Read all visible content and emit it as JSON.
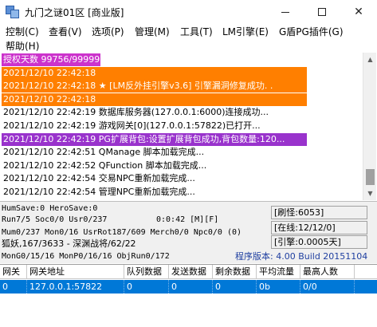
{
  "window": {
    "title": "九门之谜01区 [商业版]"
  },
  "menu": [
    "控制(C)",
    "查看(V)",
    "选项(P)",
    "管理(M)",
    "工具(T)",
    "LM引擎(E)",
    "G盾PG插件(G)",
    "帮助(H)"
  ],
  "log": [
    {
      "text": "授权天数 99756/99999",
      "bg": "#cc33cc",
      "fg": "#ffffff"
    },
    {
      "text": "2021/12/10 22:42:18",
      "bg": "#ff7f00",
      "fg": "#ffffff"
    },
    {
      "text": "2021/12/10 22:42:18 ★ [LM反外挂引擎v3.6] 引擎漏洞修复成功. .",
      "bg": "#ff7f00",
      "fg": "#ffffff"
    },
    {
      "text": "2021/12/10 22:42:18",
      "bg": "#ff7f00",
      "fg": "#ffffff"
    },
    {
      "text": "2021/12/10 22:42:19 数据库服务器(127.0.0.1:6000)连接成功...",
      "bg": "",
      "fg": "#000000"
    },
    {
      "text": "2021/12/10 22:42:19 游戏网关[0](127.0.0.1:57822)已打开...",
      "bg": "",
      "fg": "#000000"
    },
    {
      "text": "2021/12/10 22:42:19 PG扩展背包:设置扩展背包成功,背包数量:120...",
      "bg": "#9933cc",
      "fg": "#ffffff"
    },
    {
      "text": "2021/12/10 22:42:51 QManage 脚本加载完成...",
      "bg": "",
      "fg": "#000000"
    },
    {
      "text": "2021/12/10 22:42:52 QFunction 脚本加载完成...",
      "bg": "",
      "fg": "#000000"
    },
    {
      "text": "2021/12/10 22:42:54 交易NPC重新加载完成...",
      "bg": "",
      "fg": "#000000"
    },
    {
      "text": "2021/12/10 22:42:54 管理NPC重新加载完成...",
      "bg": "",
      "fg": "#000000"
    }
  ],
  "status": {
    "line1": "HumSave:0 HeroSave:0",
    "line2": "Run7/5 Soc0/0 Usr0/237",
    "timer": "0:0:42 [M][F]",
    "line3": "Mum0/237 Mon0/16 UsrRot187/609 Merch0/0 Npc0/0 (0)",
    "line4": "狐妖,167/3633 - 深渊战将/62/22",
    "line5": "MonG0/15/16 MonP0/16/16 ObjRun0/172",
    "refresh": "[刷怪:6053]",
    "online": "[在线:12/12/0]",
    "engine": "[引擎:0.0005天]",
    "version": "程序版本: 4.00 Build 20151104"
  },
  "table": {
    "headers": [
      "网关",
      "网关地址",
      "队列数据",
      "发送数据",
      "剩余数据",
      "平均流量",
      "最高人数"
    ],
    "rows": [
      [
        "0",
        "127.0.0.1:57822",
        "0",
        "0",
        "0",
        "0b",
        "0/0"
      ]
    ]
  },
  "colors": {
    "selection": "#0078d7",
    "version_text": "#1f3fa0"
  }
}
